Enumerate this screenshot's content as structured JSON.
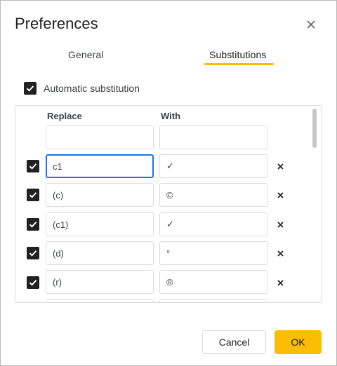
{
  "dialog": {
    "title": "Preferences",
    "close_icon": "close-icon"
  },
  "tabs": [
    {
      "label": "General",
      "selected": false
    },
    {
      "label": "Substitutions",
      "selected": true
    }
  ],
  "auto_substitution": {
    "label": "Automatic substitution",
    "checked": true
  },
  "table": {
    "headers": {
      "replace": "Replace",
      "with": "With"
    },
    "new_row": {
      "replace": "",
      "with": ""
    },
    "rows": [
      {
        "checked": true,
        "replace": "c1",
        "with": "✓",
        "focused": true
      },
      {
        "checked": true,
        "replace": "(c)",
        "with": "©"
      },
      {
        "checked": true,
        "replace": "(c1)",
        "with": "✓"
      },
      {
        "checked": true,
        "replace": "(d)",
        "with": "°"
      },
      {
        "checked": true,
        "replace": "(r)",
        "with": "®"
      }
    ],
    "delete_icon": "close-icon"
  },
  "buttons": {
    "cancel": "Cancel",
    "ok": "OK"
  },
  "colors": {
    "accent": "#fbbc04",
    "focus": "#1a73e8"
  }
}
